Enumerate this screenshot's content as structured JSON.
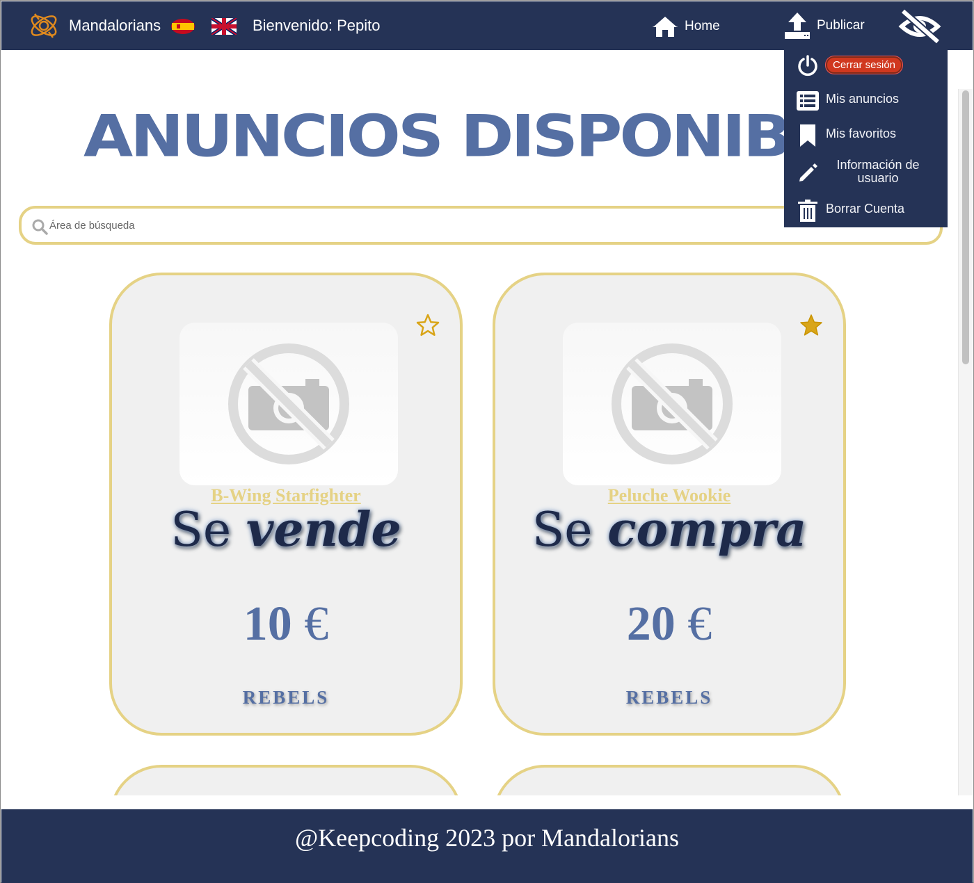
{
  "navbar": {
    "brand": "Mandalorians",
    "welcome": "Bienvenido: Pepito",
    "home_label": "Home",
    "publish_label": "Publicar",
    "languages": [
      "es-flag-icon",
      "uk-flag-icon"
    ]
  },
  "user_menu": {
    "logout": "Cerrar sesión",
    "my_ads": "Mis anuncios",
    "my_favorites": "Mis favoritos",
    "user_info_line1": "Información de",
    "user_info_line2": "usuario",
    "delete_account": "Borrar Cuenta"
  },
  "main": {
    "title": "ANUNCIOS DISPONIBLES",
    "search_placeholder": "Área de búsqueda"
  },
  "ads": [
    {
      "name": "B-Wing Starfighter",
      "type_prefix": "Se",
      "type_verb": "vende",
      "price": "10",
      "currency": "€",
      "tag": "REBELS",
      "favorite": false
    },
    {
      "name": "Peluche Wookie",
      "type_prefix": "Se",
      "type_verb": "compra",
      "price": "20",
      "currency": "€",
      "tag": "REBELS",
      "favorite": true
    }
  ],
  "footer": {
    "text": "@Keepcoding 2023 por Mandalorians"
  },
  "colors": {
    "navy": "#253356",
    "gold": "#e5d285",
    "title_blue": "#556fa3",
    "star_filled": "#d9a519",
    "logout_red": "#d0381f"
  }
}
